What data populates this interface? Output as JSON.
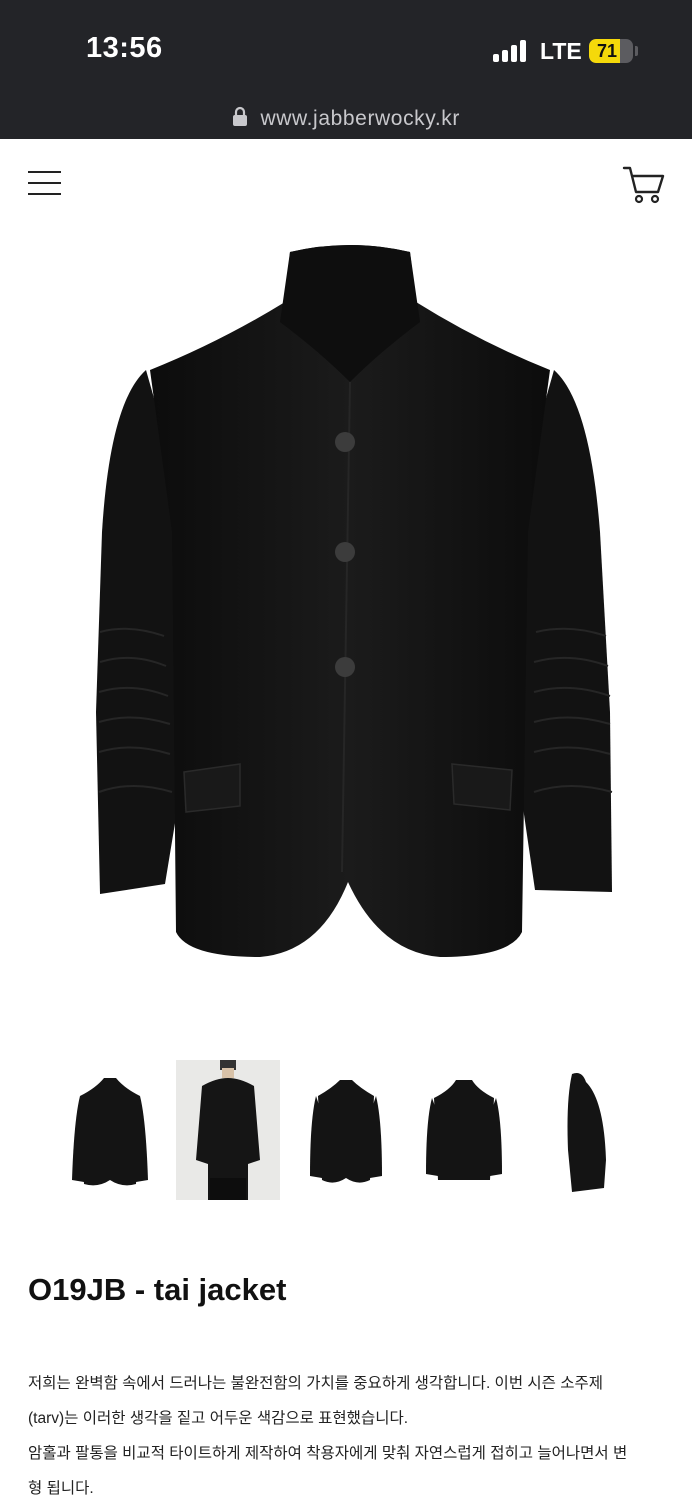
{
  "status_bar": {
    "time": "13:56",
    "network": "LTE",
    "battery_percent": "71",
    "battery_level": 0.71,
    "battery_color": "#f5d90a"
  },
  "browser": {
    "url": "www.jabberwocky.kr"
  },
  "header": {
    "menu_icon": "hamburger-menu-icon",
    "cart_icon": "shopping-cart-icon"
  },
  "product": {
    "title": "O19JB - tai jacket",
    "description_lines": [
      "저희는 완벽함 속에서 드러나는 불완전함의 가치를 중요하게 생각합니다. 이번 시즌 소주제",
      "(tarv)는 이러한 생각을 짙고 어두운 색감으로 표현했습니다.",
      "암홀과 팔통을 비교적 타이트하게 제작하여  착용자에게 맞춰 자연스럽게 접히고 늘어나면서 변",
      "형 됩니다."
    ],
    "thumbnails": [
      "front",
      "model",
      "front-open",
      "back",
      "side"
    ],
    "selected_thumbnail": 1
  },
  "colors": {
    "topbar": "#232428",
    "garment": "#141414"
  }
}
